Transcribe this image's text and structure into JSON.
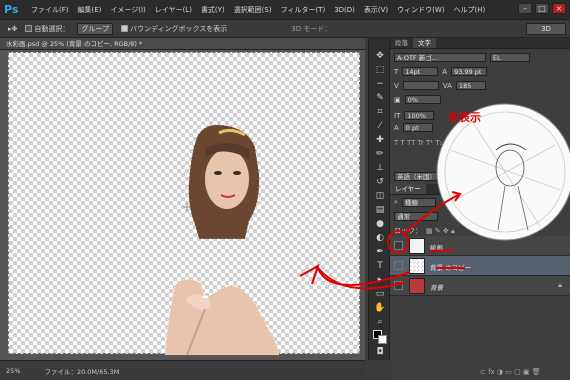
{
  "app": {
    "logo": "Ps"
  },
  "menu": [
    "ファイル(F)",
    "編集(E)",
    "イメージ(I)",
    "レイヤー(L)",
    "書式(Y)",
    "選択範囲(S)",
    "フィルター(T)",
    "3D(D)",
    "表示(V)",
    "ウィンドウ(W)",
    "ヘルプ(H)"
  ],
  "options": {
    "auto_select_label": "自動選択：",
    "auto_select_value": "グループ",
    "bounding_label": "バウンディングボックスを表示",
    "mode_3d": "3D モード：",
    "workspace": "3D"
  },
  "document": {
    "tab_title": "水彩画.psd @ 25% (背景 のコピー, RGB/8) *"
  },
  "status": {
    "zoom": "25%",
    "file": "ファイル：20.0M/65.3M"
  },
  "panels": {
    "tabs": [
      "段落",
      "文字"
    ],
    "char": {
      "font": "A-OTF 新ゴ...",
      "weight": "EL",
      "size": "14pt",
      "leading": "93.99 pt",
      "tracking": "185",
      "scale": "0%",
      "vscale": "100%",
      "baseline": "0 pt",
      "lang": "英語（米国）"
    },
    "layers_tab": "レイヤー",
    "kind": "種類",
    "blend": "通常",
    "lock": "ロック：",
    "layers": [
      {
        "name": "絵画",
        "active": false,
        "visible": false
      },
      {
        "name": "背景 のコピー",
        "active": true,
        "visible": true
      },
      {
        "name": "背景",
        "active": false,
        "visible": false
      }
    ]
  },
  "annotation": {
    "label": "非表示",
    "color": "#e00000"
  }
}
